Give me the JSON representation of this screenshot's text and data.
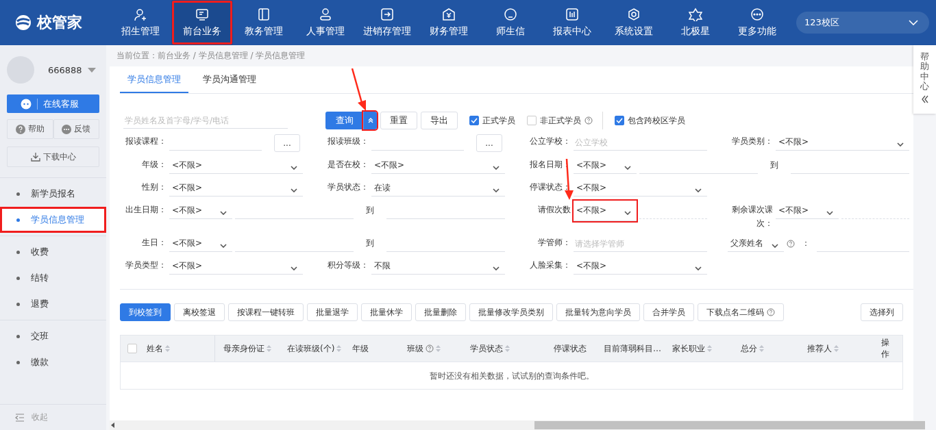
{
  "header": {
    "logo": "校管家",
    "nav": [
      {
        "label": "招生管理",
        "selected": false,
        "highlighted": false
      },
      {
        "label": "前台业务",
        "selected": true,
        "highlighted": true
      },
      {
        "label": "教务管理",
        "selected": false,
        "highlighted": false
      },
      {
        "label": "人事管理",
        "selected": false,
        "highlighted": false
      },
      {
        "label": "进销存管理",
        "selected": false,
        "highlighted": false
      },
      {
        "label": "财务管理",
        "selected": false,
        "highlighted": false
      },
      {
        "label": "师生信",
        "selected": false,
        "highlighted": false
      },
      {
        "label": "报表中心",
        "selected": false,
        "highlighted": false
      },
      {
        "label": "系统设置",
        "selected": false,
        "highlighted": false
      },
      {
        "label": "北极星",
        "selected": false,
        "highlighted": false
      },
      {
        "label": "更多功能",
        "selected": false,
        "highlighted": false
      }
    ],
    "campus": "123校区"
  },
  "sidebar": {
    "user": "666888",
    "service_button": "在线客服",
    "help_button": "帮助",
    "feedback_button": "反馈",
    "download_button": "下载中心",
    "groups": [
      [
        {
          "label": "新学员报名",
          "selected": false,
          "highlighted": false
        },
        {
          "label": "学员信息管理",
          "selected": true,
          "highlighted": true
        }
      ],
      [
        {
          "label": "收费",
          "selected": false,
          "highlighted": false
        },
        {
          "label": "结转",
          "selected": false,
          "highlighted": false
        },
        {
          "label": "退费",
          "selected": false,
          "highlighted": false
        }
      ],
      [
        {
          "label": "交班",
          "selected": false,
          "highlighted": false
        },
        {
          "label": "缴款",
          "selected": false,
          "highlighted": false
        }
      ]
    ],
    "collapse": "收起"
  },
  "breadcrumb": "当前位置：前台业务 / 学员信息管理 / 学员信息管理",
  "help_tab": "帮助中心",
  "tabs": [
    {
      "label": "学员信息管理",
      "selected": true
    },
    {
      "label": "学员沟通管理",
      "selected": false
    }
  ],
  "search": {
    "placeholder": "学员姓名及首字母/学号/电话",
    "query_button": "查询",
    "filters_expanded": true,
    "toggle_highlighted": true,
    "reset_button": "重置",
    "export_button": "导出",
    "options": [
      {
        "label": "正式学员",
        "checked": true,
        "help": false
      },
      {
        "label": "非正式学员",
        "checked": false,
        "help": true
      },
      {
        "label": "包含跨校区学员",
        "checked": true,
        "help": false
      }
    ]
  },
  "filters": [
    [
      {
        "kind": "text",
        "label": "报读课程：",
        "picker": "..."
      },
      {
        "kind": "text",
        "label": "报读班级：",
        "picker": "..."
      },
      {
        "kind": "text",
        "label": "公立学校：",
        "placeholder": "公立学校"
      },
      {
        "kind": "select",
        "label": "学员类别：",
        "value": "<不限>"
      }
    ],
    [
      {
        "kind": "select",
        "label": "年级：",
        "value": "<不限>"
      },
      {
        "kind": "select",
        "label": "是否在校：",
        "value": "<不限>"
      },
      {
        "kind": "range",
        "label": "报名日期：",
        "value": "<不限>",
        "separator": "到"
      }
    ],
    [
      {
        "kind": "select",
        "label": "性别：",
        "value": "<不限>"
      },
      {
        "kind": "select",
        "label": "学员状态：",
        "value": "在读"
      },
      {
        "kind": "select",
        "label": "停课状态：",
        "value": "<不限>"
      },
      {
        "kind": "empty"
      }
    ],
    [
      {
        "kind": "range",
        "label": "出生日期：",
        "value": "<不限>",
        "separator": "到"
      },
      {
        "kind": "select-input",
        "label": "请假次数",
        "value": "<不限>",
        "highlighted": true
      },
      {
        "kind": "select-input",
        "label": "剩余课次课次：",
        "value": "<不限>",
        "highlighted": false
      }
    ],
    [
      {
        "kind": "range",
        "label": "生日：",
        "value": "<不限>",
        "separator": "到"
      },
      {
        "kind": "text",
        "label": "学管师：",
        "placeholder": "请选择学管师"
      },
      {
        "kind": "field-select",
        "value": "父亲姓名",
        "separator": "："
      }
    ],
    [
      {
        "kind": "select",
        "label": "学员类型：",
        "value": "<不限>"
      },
      {
        "kind": "select",
        "label": "积分等级：",
        "value": "不限"
      },
      {
        "kind": "select",
        "label": "人脸采集：",
        "value": "<不限>"
      },
      {
        "kind": "empty"
      }
    ]
  ],
  "actions": [
    {
      "label": "到校签到",
      "primary": true,
      "help": false
    },
    {
      "label": "离校签退",
      "primary": false,
      "help": false
    },
    {
      "label": "按课程一键转班",
      "primary": false,
      "help": false
    },
    {
      "label": "批量退学",
      "primary": false,
      "help": false
    },
    {
      "label": "批量休学",
      "primary": false,
      "help": false
    },
    {
      "label": "批量删除",
      "primary": false,
      "help": false
    },
    {
      "label": "批量修改学员类别",
      "primary": false,
      "help": false
    },
    {
      "label": "批量转为意向学员",
      "primary": false,
      "help": false
    },
    {
      "label": "合并学员",
      "primary": false,
      "help": false
    },
    {
      "label": "下载点名二维码",
      "primary": false,
      "help": true
    }
  ],
  "column_picker": "选择列",
  "table": {
    "select_all_checked": false,
    "columns": [
      {
        "label": "姓名",
        "sortable": true,
        "help": false
      },
      {
        "label": "母亲身份证",
        "sortable": true,
        "help": false
      },
      {
        "label": "在读班级(个)",
        "sortable": true,
        "help": false
      },
      {
        "label": "年级",
        "sortable": false,
        "help": false
      },
      {
        "label": "班级",
        "sortable": true,
        "help": true
      },
      {
        "label": "学员状态",
        "sortable": true,
        "help": false
      },
      {
        "label": "停课状态",
        "sortable": false,
        "help": false
      },
      {
        "label": "目前薄弱科目…",
        "sortable": false,
        "help": false
      },
      {
        "label": "家长职业",
        "sortable": true,
        "help": false
      },
      {
        "label": "总分",
        "sortable": true,
        "help": false
      },
      {
        "label": "推荐人",
        "sortable": true,
        "help": false
      },
      {
        "label": "操作",
        "sortable": false,
        "help": false
      }
    ],
    "empty_text": "暂时还没有相关数据，试试别的查询条件吧。"
  }
}
